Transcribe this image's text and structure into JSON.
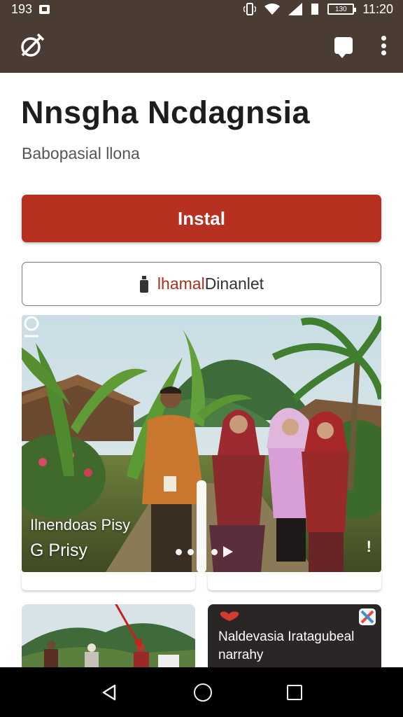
{
  "status_bar": {
    "left_text": "193",
    "battery_text": "130",
    "time": "11:20",
    "icons": [
      "notification-box-icon",
      "vibrate-icon",
      "wifi-icon",
      "signal-icon",
      "sim-icon",
      "battery-icon"
    ]
  },
  "app_bar": {
    "logo_icon": "satellite-icon",
    "actions": [
      "chat-icon",
      "overflow-menu-icon"
    ],
    "background": "#4a3c33"
  },
  "app": {
    "title": "Nnsgha Ncdagnsia",
    "subtitle": "Babopasial llona"
  },
  "buttons": {
    "install_label": "Instal",
    "install_color": "#b8301f",
    "secondary_prefix": "lhamal",
    "secondary_suffix": "Dinanlet",
    "secondary_icon": "bottle-icon"
  },
  "hero": {
    "caption_line1": "Ilnendoas Pisy",
    "caption_line2": "G Prisy",
    "exclaim": "!",
    "corner_icon": "pin-icon"
  },
  "cards": {
    "right_text": "Naldevasia Iratagubeal narrahy"
  },
  "nav": {
    "items": [
      "back-icon",
      "home-icon",
      "recent-apps-icon"
    ]
  }
}
